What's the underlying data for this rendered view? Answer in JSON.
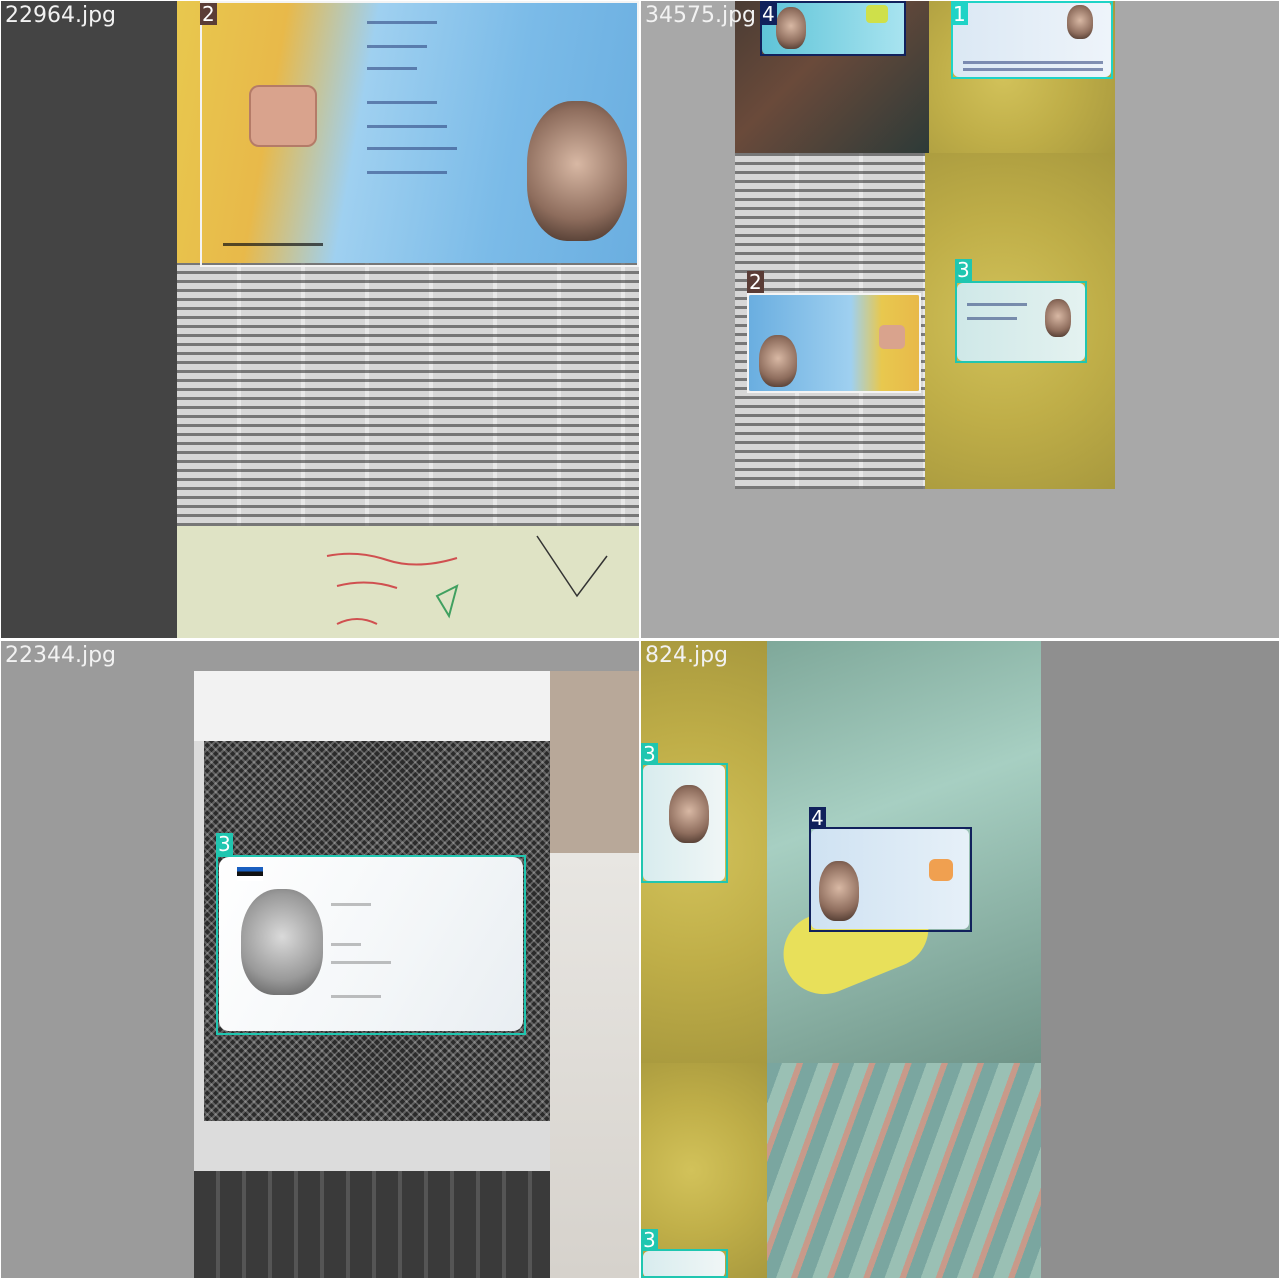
{
  "colors": {
    "box_1": "#1fd3c6",
    "box_2": "#f4f4f4",
    "box_3": "#20c6b0",
    "box_4": "#11215c",
    "tag_2_bg": "#5a3c36"
  },
  "tiles": [
    {
      "filename": "22964.jpg",
      "detections": [
        {
          "label": "2"
        }
      ]
    },
    {
      "filename": "34575.jpg",
      "detections": [
        {
          "label": "4"
        },
        {
          "label": "1"
        },
        {
          "label": "3"
        },
        {
          "label": "2"
        }
      ]
    },
    {
      "filename": "22344.jpg",
      "detections": [
        {
          "label": "3"
        }
      ]
    },
    {
      "filename": "824.jpg",
      "detections": [
        {
          "label": "3"
        },
        {
          "label": "4"
        },
        {
          "label": "3"
        }
      ]
    }
  ]
}
